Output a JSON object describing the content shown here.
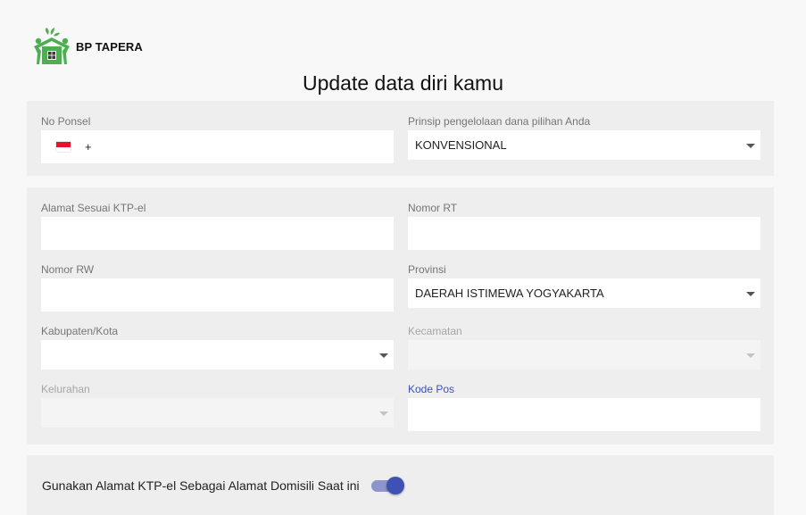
{
  "brand": {
    "name": "BP TAPERA",
    "logo_icon": "house-people-logo-icon",
    "logo_color": "#4caf50"
  },
  "page": {
    "title": "Update data diri kamu"
  },
  "contact": {
    "phone": {
      "label": "No Ponsel",
      "flag_icon": "indonesia-flag-icon",
      "prefix": "+",
      "value": ""
    },
    "fund_principle": {
      "label": "Prinsip pengelolaan dana pilihan Anda",
      "value": "KONVENSIONAL"
    }
  },
  "address": {
    "ktp_address": {
      "label": "Alamat Sesuai KTP-el",
      "value": ""
    },
    "rt": {
      "label": "Nomor RT",
      "value": ""
    },
    "rw": {
      "label": "Nomor RW",
      "value": ""
    },
    "province": {
      "label": "Provinsi",
      "value": "DAERAH ISTIMEWA YOGYAKARTA"
    },
    "city": {
      "label": "Kabupaten/Kota",
      "value": ""
    },
    "district": {
      "label": "Kecamatan",
      "value": "",
      "disabled": true
    },
    "village": {
      "label": "Kelurahan",
      "value": "",
      "disabled": true
    },
    "postal_code": {
      "label": "Kode Pos",
      "value": "",
      "focused": true
    }
  },
  "domicile": {
    "toggle_label": "Gunakan Alamat KTP-el Sebagai Alamat Domisili Saat ini",
    "toggle_on": true
  },
  "colors": {
    "accent": "#3f51b5",
    "accent_track": "#8c96cc",
    "card_bg": "#eeeeee",
    "page_bg": "#f8f8f8"
  }
}
